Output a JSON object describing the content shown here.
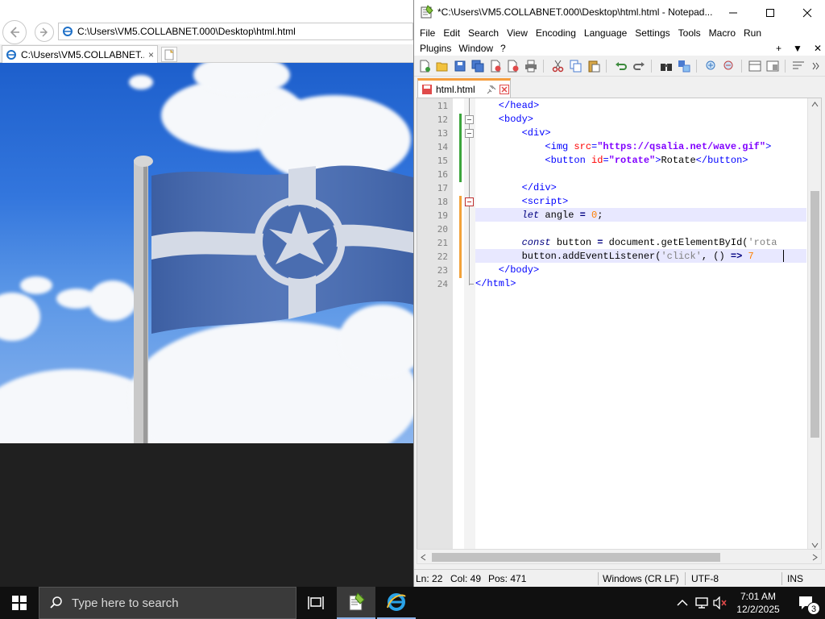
{
  "ie": {
    "address": "C:\\Users\\VM5.COLLABNET.000\\Desktop\\html.html",
    "tab_title": "C:\\Users\\VM5.COLLABNET....",
    "tab_close": "×"
  },
  "npp": {
    "title": "*C:\\Users\\VM5.COLLABNET.000\\Desktop\\html.html - Notepad...",
    "menu_row1": [
      "File",
      "Edit",
      "Search",
      "View",
      "Encoding",
      "Language",
      "Settings",
      "Tools",
      "Macro",
      "Run"
    ],
    "menu_row2": [
      "Plugins",
      "Window",
      "?"
    ],
    "menu_right": [
      "+",
      "▼",
      "✕"
    ],
    "tab_label": "html.html",
    "lines": [
      {
        "no": "11",
        "html": "<span class='tag'>    &lt;/head&gt;</span>"
      },
      {
        "no": "12",
        "html": "<span class='tag'>    &lt;body&gt;</span>"
      },
      {
        "no": "13",
        "html": "<span class='tag'>        &lt;div&gt;</span>"
      },
      {
        "no": "14",
        "html": "<span class='tag'>            &lt;img </span><span class='attr'>src</span><span class='tag'>=</span><span class='str'>\"https://qsalia.net/wave.gif\"</span><span class='tag'>&gt;</span>"
      },
      {
        "no": "15",
        "html": "<span class='tag'>            &lt;button </span><span class='attr'>id</span><span class='tag'>=</span><span class='str'>\"rotate\"</span><span class='tag'>&gt;</span><span class='txt'>Rotate</span><span class='tag'>&lt;/button&gt;</span>"
      },
      {
        "no": "16",
        "html": ""
      },
      {
        "no": "17",
        "html": "<span class='tag'>        &lt;/div&gt;</span>"
      },
      {
        "no": "18",
        "html": "<span class='tag'>        &lt;script&gt;</span>"
      },
      {
        "no": "19",
        "html": "<span class='kw'>        let</span><span class='txt'> angle </span><span class='op'>=</span><span class='txt'> </span><span class='num'>0</span><span class='txt'>;</span>"
      },
      {
        "no": "20",
        "html": ""
      },
      {
        "no": "21",
        "html": "<span class='kw'>        const</span><span class='txt'> button </span><span class='op'>=</span><span class='txt'> document.getElementById(</span><span class='sq'>'rota</span>"
      },
      {
        "no": "22",
        "html": "<span class='txt'>        button.addEventListener(</span><span class='sq'>'click'</span><span class='txt'>, () </span><span class='op'>=&gt;</span><span class='txt'> </span><span class='num'>7</span>"
      },
      {
        "no": "23",
        "html": "<span class='tag'>    &lt;/body&gt;</span>"
      },
      {
        "no": "24",
        "html": "<span class='tag'>&lt;/html&gt;</span>"
      }
    ],
    "status": {
      "ln": "Ln: 22",
      "col": "Col: 49",
      "pos": "Pos: 471",
      "eol": "Windows (CR LF)",
      "encoding": "UTF-8",
      "mode": "INS"
    }
  },
  "taskbar": {
    "search_placeholder": "Type here to search",
    "time": "7:01 AM",
    "date": "12/2/2025",
    "notification_count": "3"
  },
  "colors": {
    "npp_accent": "#f59d3d",
    "taskbar": "#101010",
    "sky_blue": "#2f72da"
  }
}
